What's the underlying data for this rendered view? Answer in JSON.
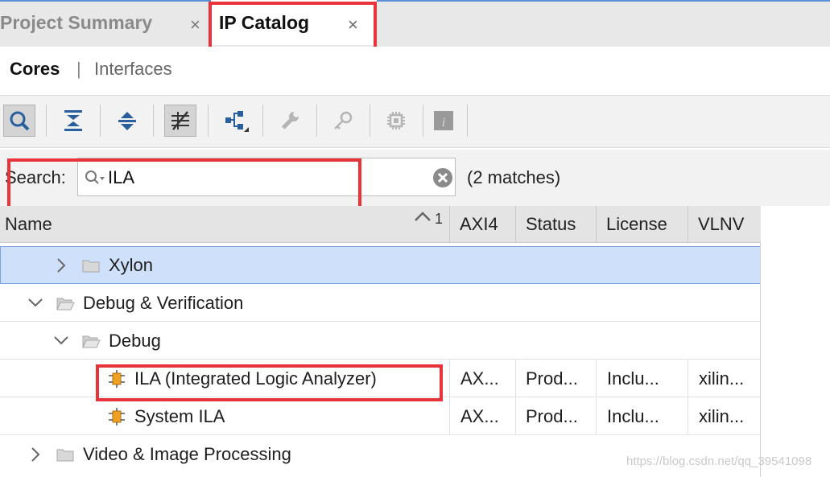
{
  "tabs": [
    {
      "label": "Project Summary",
      "close": "×"
    },
    {
      "label": "IP Catalog",
      "close": "×"
    }
  ],
  "subtabs": {
    "cores": "Cores",
    "separator": "|",
    "interfaces": "Interfaces"
  },
  "toolbar": [
    "search-icon",
    "collapse-all-icon",
    "expand-all-icon",
    "filter-icon",
    "hierarchy-icon",
    "wrench-icon",
    "key-icon",
    "chip-icon",
    "info-icon"
  ],
  "search": {
    "label": "Search:",
    "value": "ILA",
    "matches": "(2 matches)"
  },
  "table": {
    "columns": [
      "Name",
      "AXI4",
      "Status",
      "License",
      "VLNV"
    ],
    "sort_indicator": "1",
    "rows": [
      {
        "name": "Xylon",
        "type": "folder",
        "expanded": false,
        "selected": true
      },
      {
        "name": "Debug & Verification",
        "type": "folder",
        "expanded": true
      },
      {
        "name": "Debug",
        "type": "folder",
        "expanded": true
      },
      {
        "name": "ILA (Integrated Logic Analyzer)",
        "type": "ip",
        "axi4": "AX...",
        "status": "Prod...",
        "license": "Inclu...",
        "vlnv": "xilin..."
      },
      {
        "name": "System ILA",
        "type": "ip",
        "axi4": "AX...",
        "status": "Prod...",
        "license": "Inclu...",
        "vlnv": "xilin..."
      },
      {
        "name": "Video & Image Processing",
        "type": "folder",
        "expanded": false
      }
    ]
  },
  "watermark": "https://blog.csdn.net/qq_39541098",
  "colors": {
    "highlight": "#e8333a",
    "selection": "#cfe0fb",
    "ip_icon": "#f0a020"
  }
}
